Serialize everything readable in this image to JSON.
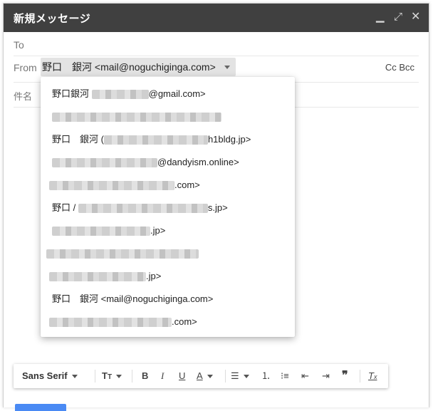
{
  "window": {
    "title": "新規メッセージ"
  },
  "fields": {
    "to_label": "To",
    "from_label": "From",
    "from_value": "野口　銀河 <mail@noguchiginga.com>",
    "cc_bcc": "Cc Bcc",
    "subject_label": "件名"
  },
  "from_options": [
    {
      "prefix": "野口銀河 ",
      "suffix": "@gmail.com>"
    },
    {
      "prefix": "",
      "suffix": ""
    },
    {
      "prefix": "野口　銀河 (",
      "suffix": "h1bldg.jp>"
    },
    {
      "prefix": "",
      "suffix": "@dandyism.online>"
    },
    {
      "prefix": "",
      "suffix": ".com>"
    },
    {
      "prefix": "野口 / ",
      "suffix": "s.jp>"
    },
    {
      "prefix": "",
      "suffix": ".jp>"
    },
    {
      "prefix": "",
      "suffix": ""
    },
    {
      "prefix": "",
      "suffix": ".jp>"
    },
    {
      "prefix": "野口　銀河 <mail@noguchiginga.com>",
      "suffix": ""
    },
    {
      "prefix": "",
      "suffix": ".com>"
    }
  ],
  "toolbar": {
    "font": "Sans Serif"
  },
  "colors": {
    "titlebar": "#404040",
    "send_button": "#4a8af4"
  }
}
